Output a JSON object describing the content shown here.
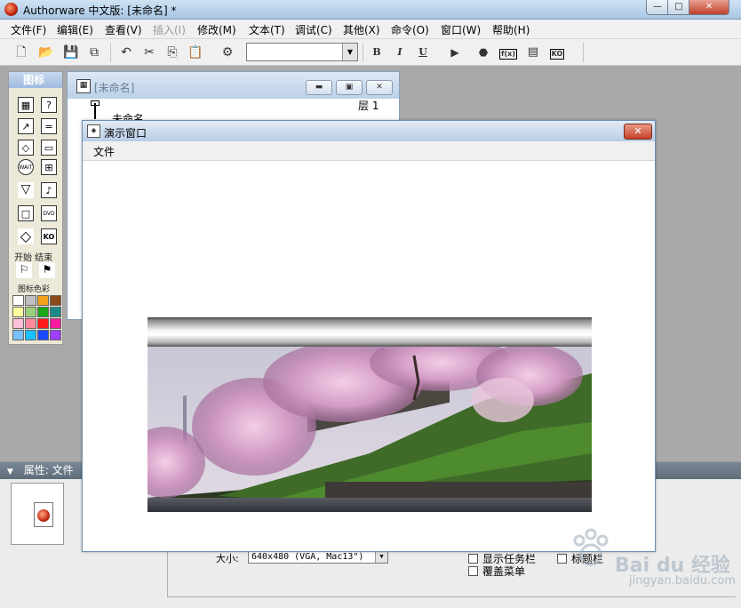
{
  "app": {
    "title": "Authorware 中文版: [未命名] *",
    "controls": {
      "minimize": "—",
      "maximize": "□",
      "close": "✕"
    }
  },
  "menubar": [
    "文件(F)",
    "编辑(E)",
    "查看(V)",
    "插入(I)",
    "修改(M)",
    "文本(T)",
    "调试(C)",
    "其他(X)",
    "命令(O)",
    "窗口(W)",
    "帮助(H)"
  ],
  "menubar_disabled": [
    "插入(I)"
  ],
  "toolbar": {
    "font_combo_value": "",
    "bold": "B",
    "italic": "I",
    "underline": "U",
    "fx_label": "f(x)",
    "ko_label": "KO"
  },
  "palette": {
    "title": "图标",
    "start_end_label": "开始 结束",
    "color_label": "图标色彩",
    "icon_labels": {
      "wait": "WAIT",
      "dvd": "DVD",
      "ko": "KO"
    },
    "colors": [
      "#ffffff",
      "#c0c0c0",
      "#f4a01a",
      "#8b4a1a",
      "#ffffa0",
      "#9ad07a",
      "#1aa81a",
      "#1a8a8a",
      "#ffc0d8",
      "#ff8aa0",
      "#ff1a1a",
      "#ff1aa0",
      "#7ac0ff",
      "#1ac0ff",
      "#1a4aff",
      "#a040ff"
    ]
  },
  "design_window": {
    "title": "[未命名]",
    "layer": "层 1",
    "flow_item": "未命名"
  },
  "presentation_window": {
    "title": "演示窗口",
    "menu_file": "文件",
    "close": "✕"
  },
  "properties": {
    "header": "属性: 文件",
    "size_label": "大小:",
    "size_value": "640x480 (VGA, Mac13\")",
    "show_taskbar": "显示任务栏",
    "cover_menu": "覆盖菜单",
    "partial_checkbox_label": "标题栏"
  },
  "watermark": {
    "brand": "Bai du 经验",
    "url": "jingyan.baidu.com"
  }
}
